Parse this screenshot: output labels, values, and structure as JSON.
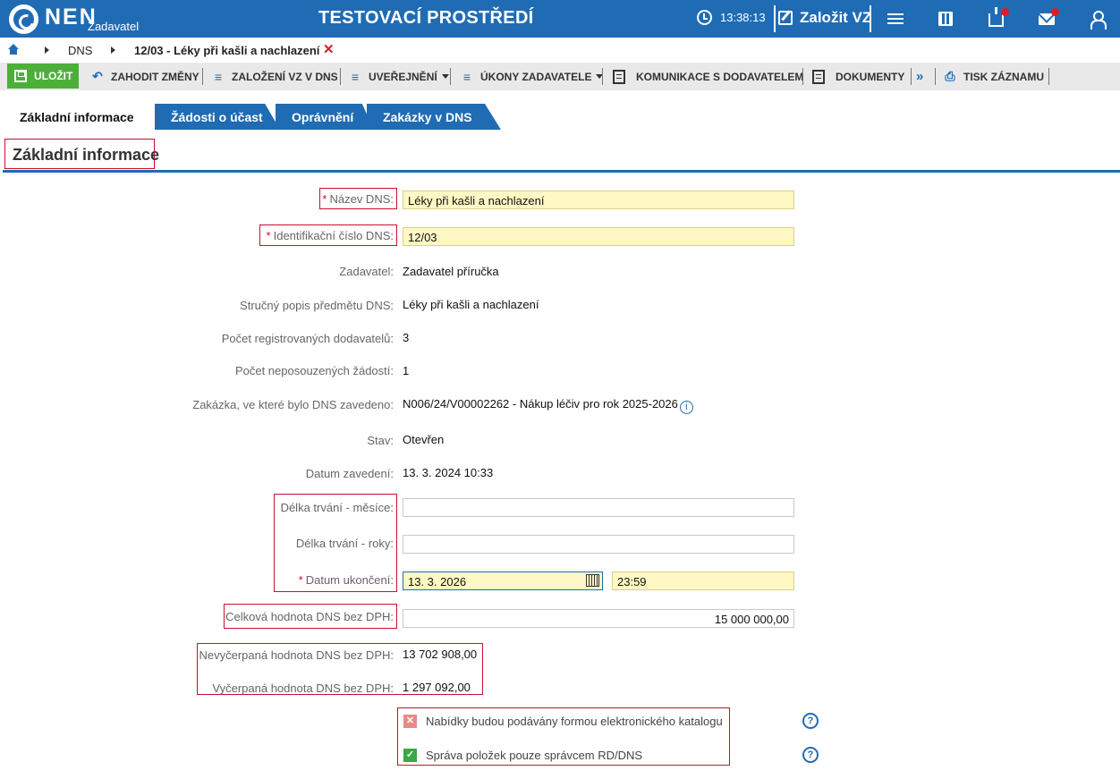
{
  "header": {
    "logo": "NEN",
    "logo_sub": "Zadavatel",
    "env_title": "TESTOVACÍ PROSTŘEDÍ",
    "clock": "13:38:13",
    "new_vz": "Založit VZ"
  },
  "breadcrumb": {
    "items": [
      "DNS",
      "12/03 - Léky při kašli a nachlazení"
    ]
  },
  "toolbar": {
    "save": "ULOŽIT",
    "discard": "ZAHODIT ZMĚNY",
    "create_vz": "ZALOŽENÍ VZ V DNS",
    "publish": "UVEŘEJNĚNÍ",
    "actions": "ÚKONY ZADAVATELE",
    "communication": "KOMUNIKACE S DODAVATELEM",
    "documents": "DOKUMENTY",
    "print": "TISK ZÁZNAMU"
  },
  "tabs": [
    "Základní informace",
    "Žádosti o účast",
    "Oprávnění",
    "Zakázky v DNS"
  ],
  "section_title": "Základní informace",
  "form": {
    "name_label": "Název DNS:",
    "name_value": "Léky při kašli a nachlazení",
    "id_label": "Identifikační číslo DNS:",
    "id_value": "12/03",
    "contracting_label": "Zadavatel:",
    "contracting_value": "Zadavatel příručka",
    "desc_label": "Stručný popis předmětu DNS:",
    "desc_value": "Léky při kašli a nachlazení",
    "suppliers_label": "Počet registrovaných dodavatelů:",
    "suppliers_value": "3",
    "unreviewed_label": "Počet neposouzených žádostí:",
    "unreviewed_value": "1",
    "contract_label": "Zakázka, ve které bylo DNS zavedeno:",
    "contract_value": "N006/24/V00002262 - Nákup léčiv pro rok 2025-2026",
    "state_label": "Stav:",
    "state_value": "Otevřen",
    "date_label": "Datum zavedení:",
    "date_value": "13. 3. 2024 10:33",
    "months_label": "Délka trvání - měsíce:",
    "months_value": "",
    "years_label": "Délka trvání - roky:",
    "years_value": "",
    "end_label": "Datum ukončení:",
    "end_date": "13. 3. 2026",
    "end_time": "23:59",
    "total_label": "Celková hodnota DNS bez DPH:",
    "total_value": "15 000 000,00",
    "remaining_label": "Nevyčerpaná hodnota DNS bez DPH:",
    "remaining_value": "13 702 908,00",
    "used_label": "Vyčerpaná hodnota DNS bez DPH:",
    "used_value": "1 297 092,00",
    "catalog_label": "Nabídky budou podávány formou elektronického katalogu",
    "catalog_checked": false,
    "admin_label": "Správa položek pouze správcem RD/DNS",
    "admin_checked": true
  },
  "colors": {
    "brand_blue": "#1f6cb4",
    "save_green": "#4caf3a",
    "required_red": "#c8102e",
    "field_yellow": "#fff8c4"
  }
}
